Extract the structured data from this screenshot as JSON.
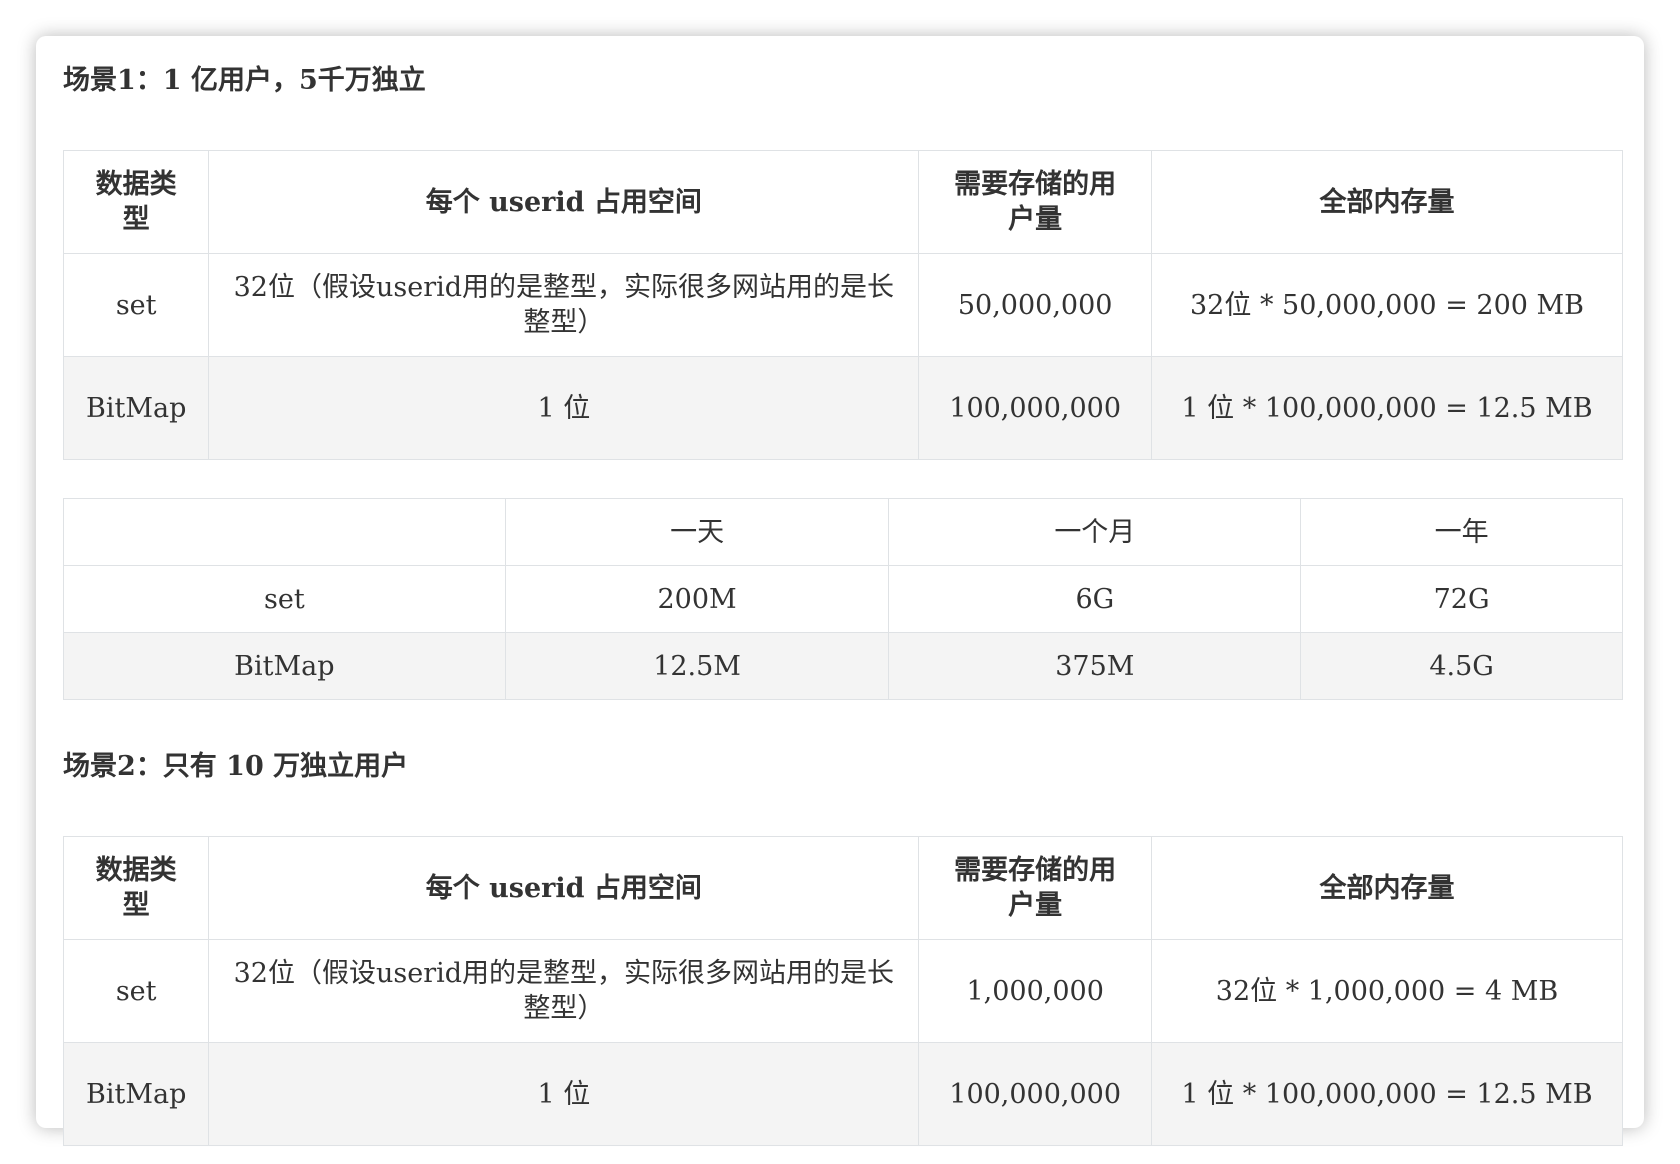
{
  "scene1": {
    "title": "场景1：1 亿用户，5千万独立",
    "table": {
      "headers": {
        "type": "数据类型",
        "space_pre": "每个 ",
        "space_bold": "userid",
        "space_post": " 占用空间",
        "count": "需要存储的用户量",
        "total": "全部内存量"
      },
      "rows": [
        [
          "set",
          "32位（假设userid用的是整型，实际很多网站用的是长整型）",
          "50,000,000",
          "32位 * 50,000,000 = 200 MB"
        ],
        [
          "BitMap",
          "1 位",
          "100,000,000",
          "1 位 * 100,000,000 = 12.5 MB"
        ]
      ]
    },
    "period_table": {
      "headers": [
        "",
        "一天",
        "一个月",
        "一年"
      ],
      "rows": [
        [
          "set",
          "200M",
          "6G",
          "72G"
        ],
        [
          "BitMap",
          "12.5M",
          "375M",
          "4.5G"
        ]
      ]
    }
  },
  "scene2": {
    "title": "场景2：只有 10 万独立用户",
    "table": {
      "headers": {
        "type": "数据类型",
        "space_pre": "每个 ",
        "space_bold": "userid",
        "space_post": " 占用空间",
        "count": "需要存储的用户量",
        "total": "全部内存量"
      },
      "rows": [
        [
          "set",
          "32位（假设userid用的是整型，实际很多网站用的是长整型）",
          "1,000,000",
          "32位 * 1,000,000 = 4 MB"
        ],
        [
          "BitMap",
          "1 位",
          "100,000,000",
          "1 位 * 100,000,000 = 12.5 MB"
        ]
      ]
    }
  }
}
